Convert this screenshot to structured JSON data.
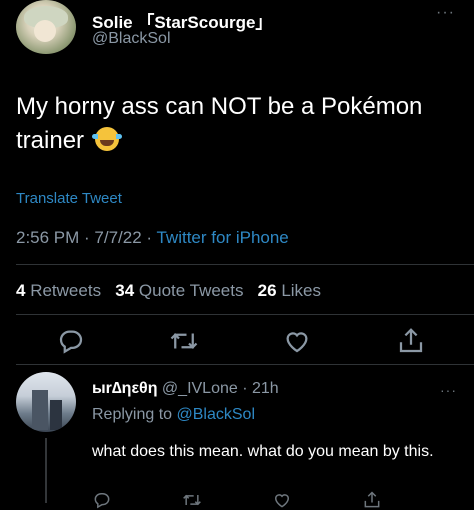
{
  "tweet": {
    "author_name": "Solie 「StarScourge」",
    "author_handle": "@BlackSol",
    "more": "···",
    "text_line1": "My horny ass can NOT be a Pokémon",
    "text_line2": "trainer",
    "emoji": "face-with-tears-of-joy-emoji",
    "translate": "Translate Tweet",
    "time": "2:56 PM · 7/7/22 · ",
    "source": "Twitter for iPhone",
    "stats": {
      "retweets_count": "4",
      "retweets_label": "Retweets",
      "quotes_count": "34",
      "quotes_label": "Quote Tweets",
      "likes_count": "26",
      "likes_label": "Likes"
    },
    "actions": [
      "reply-icon",
      "retweet-icon",
      "like-icon",
      "share-icon"
    ]
  },
  "reply": {
    "author_name": "ыr∆ηεθη",
    "handle_time": "@_IVLone · 21h",
    "more": "···",
    "replying_prefix": "Replying to ",
    "replying_to": "@BlackSol",
    "text": "what does this mean. what do you mean by this."
  },
  "colors": {
    "background": "#000000",
    "text": "#e7e9ea",
    "muted": "#8b98a5",
    "link": "#2e88c4"
  }
}
